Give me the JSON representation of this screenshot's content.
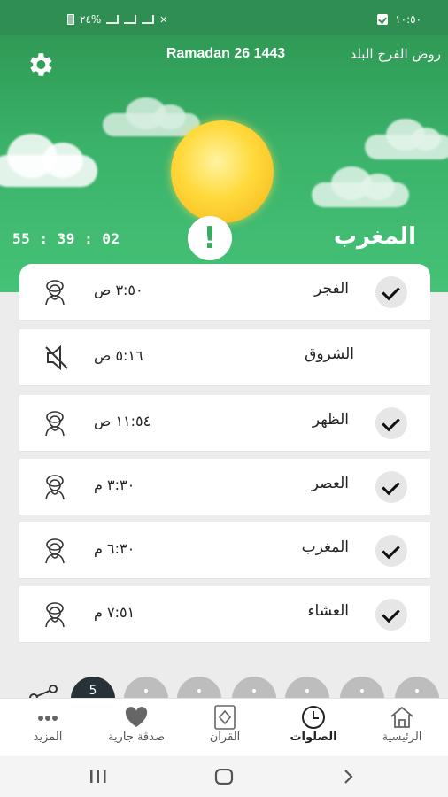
{
  "status_bar": {
    "time": "١٠:٥٠",
    "battery": "٢٤%"
  },
  "header": {
    "city": "روض الفرج البلد",
    "hijri_date": "Ramadan 26 1443",
    "countdown": "55 : 39 : 02",
    "current_prayer": "المغرب"
  },
  "prayers": [
    {
      "name": "الفجر",
      "time": "٣:٥٠ ص",
      "checked": true,
      "icon": "person-icon"
    },
    {
      "name": "الشروق",
      "time": "٥:١٦ ص",
      "checked": false,
      "icon": "mute-icon"
    },
    {
      "name": "الظهر",
      "time": "١١:٥٤ ص",
      "checked": true,
      "icon": "person-icon"
    },
    {
      "name": "العصر",
      "time": "٣:٣٠ م",
      "checked": true,
      "icon": "person-icon"
    },
    {
      "name": "المغرب",
      "time": "٦:٣٠ م",
      "checked": true,
      "icon": "person-icon"
    },
    {
      "name": "العشاء",
      "time": "٧:٥١ م",
      "checked": true,
      "icon": "person-icon"
    }
  ],
  "day_selector": {
    "active_label": "5"
  },
  "bottom_nav": [
    {
      "label": "الرئيسية",
      "icon": "home-icon",
      "active": false
    },
    {
      "label": "الصلوات",
      "icon": "clock-icon",
      "active": true
    },
    {
      "label": "القران",
      "icon": "quran-icon",
      "active": false
    },
    {
      "label": "صدقة جارية",
      "icon": "heart-icon",
      "active": false
    },
    {
      "label": "المزيد",
      "icon": "more-icon",
      "active": false
    }
  ],
  "colors": {
    "header_green": "#3bb36a",
    "status_green": "#2f8f52",
    "sun_yellow": "#ffd93a",
    "active_dot": "#263238"
  }
}
